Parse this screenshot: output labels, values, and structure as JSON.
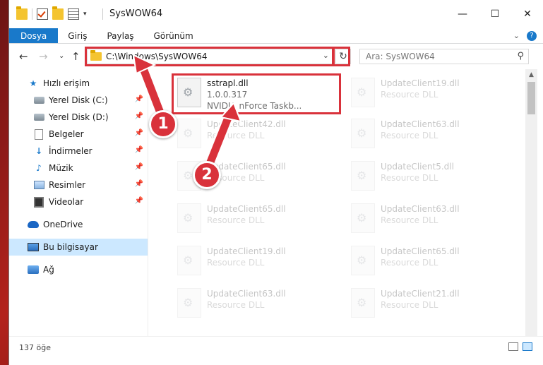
{
  "window": {
    "title": "SysWOW64",
    "minimize": "—",
    "maximize": "☐",
    "close": "✕"
  },
  "ribbon": {
    "tabs": [
      "Dosya",
      "Giriş",
      "Paylaş",
      "Görünüm"
    ],
    "expand": "⌄",
    "help": "?"
  },
  "addressbar": {
    "path": "C:\\Windows\\SysWOW64",
    "search_placeholder": "Ara: SysWOW64"
  },
  "nav": {
    "items": [
      {
        "label": "Hızlı erişim",
        "icon": "star-icon",
        "pinned": false
      },
      {
        "label": "Yerel Disk (C:)",
        "icon": "drive-icon",
        "pinned": true
      },
      {
        "label": "Yerel Disk (D:)",
        "icon": "drive-icon",
        "pinned": true
      },
      {
        "label": "Belgeler",
        "icon": "documents-icon",
        "pinned": true
      },
      {
        "label": "İndirmeler",
        "icon": "downloads-icon",
        "pinned": true
      },
      {
        "label": "Müzik",
        "icon": "music-icon",
        "pinned": true
      },
      {
        "label": "Resimler",
        "icon": "pictures-icon",
        "pinned": true
      },
      {
        "label": "Videolar",
        "icon": "videos-icon",
        "pinned": true
      },
      {
        "label": "OneDrive",
        "icon": "onedrive-icon",
        "pinned": false
      },
      {
        "label": "Bu bilgisayar",
        "icon": "this-pc-icon",
        "pinned": false
      },
      {
        "label": "Ağ",
        "icon": "network-icon",
        "pinned": false
      }
    ]
  },
  "files": {
    "highlighted": {
      "name": "sstrapl.dll",
      "version": "1.0.0.317",
      "description": "NVIDIA nForce Taskb..."
    },
    "left_column": [
      {
        "name": "UpdateClient42.dll",
        "desc": "Resource DLL"
      },
      {
        "name": "UpdateClient65.dll",
        "desc": "Resource DLL"
      },
      {
        "name": "UpdateClient65.dll",
        "desc": "Resource DLL"
      },
      {
        "name": "UpdateClient19.dll",
        "desc": "Resource DLL"
      },
      {
        "name": "UpdateClient63.dll",
        "desc": "Resource DLL"
      }
    ],
    "right_column": [
      {
        "name": "UpdateClient19.dll",
        "desc": "Resource DLL"
      },
      {
        "name": "UpdateClient63.dll",
        "desc": "Resource DLL"
      },
      {
        "name": "UpdateClient5.dll",
        "desc": "Resource DLL"
      },
      {
        "name": "UpdateClient63.dll",
        "desc": "Resource DLL"
      },
      {
        "name": "UpdateClient65.dll",
        "desc": "Resource DLL"
      },
      {
        "name": "UpdateClient21.dll",
        "desc": "Resource DLL"
      }
    ]
  },
  "status": {
    "count": "137 öğe"
  },
  "annotations": {
    "step1": "1",
    "step2": "2",
    "color": "#d9323b"
  }
}
